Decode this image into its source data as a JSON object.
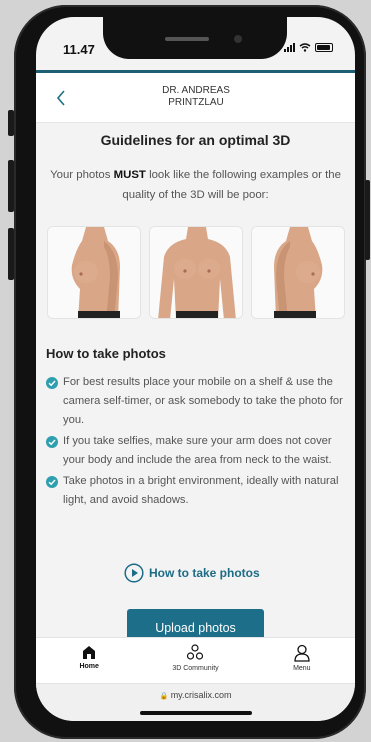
{
  "status_bar": {
    "time": "11.47"
  },
  "navbar": {
    "title": "DR. ANDREAS\nPRINTZLAU"
  },
  "guidelines": {
    "title": "Guidelines for an optimal 3D",
    "text_before": "Your photos ",
    "text_bold": "MUST",
    "text_after": " look like the following examples or the quality of the 3D will be poor:"
  },
  "example_photos": [
    {
      "view": "left-side",
      "icon": "torso-side-left"
    },
    {
      "view": "front",
      "icon": "torso-front"
    },
    {
      "view": "right-side",
      "icon": "torso-side-right"
    }
  ],
  "how_to": {
    "heading": "How to take photos",
    "tips": [
      "For best results place your mobile on a shelf & use the camera self-timer, or ask somebody to take the photo for you.",
      "If you take selfies, make sure your arm does not cover your body and include the area from neck to the waist.",
      "Take photos in a bright environment, ideally with natural light, and avoid shadows."
    ],
    "video_link_label": "How to take photos"
  },
  "upload_button_label": "Upload photos",
  "tabs": [
    {
      "label": "Home",
      "icon": "home-icon",
      "active": true
    },
    {
      "label": "3D Community",
      "icon": "community-icon",
      "active": false
    },
    {
      "label": "Menu",
      "icon": "user-icon",
      "active": false
    }
  ],
  "browser": {
    "url": "my.crisalix.com"
  },
  "colors": {
    "accent": "#1d6e89",
    "check": "#2e9fae",
    "header_bar": "#1d5e72",
    "background": "#f3f3f3"
  }
}
